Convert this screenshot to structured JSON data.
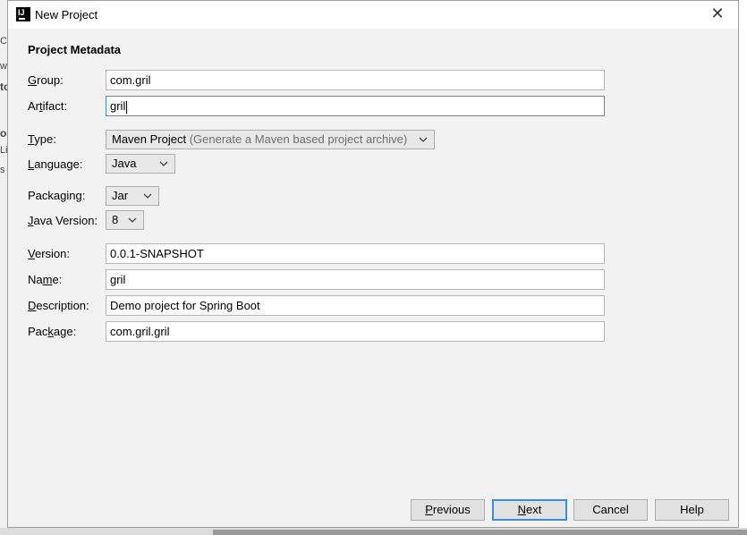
{
  "background_fragments": [
    "C",
    "w",
    "to",
    "oc",
    "Li",
    "s"
  ],
  "window": {
    "title": "New Project",
    "close_glyph": "✕"
  },
  "section": {
    "title": "Project Metadata"
  },
  "fields": {
    "group": {
      "label_pre": "",
      "label_accel": "G",
      "label_post": "roup:",
      "value": "com.gril"
    },
    "artifact": {
      "label_pre": "Ar",
      "label_accel": "t",
      "label_post": "ifact:",
      "value": "gril"
    },
    "version": {
      "label_pre": "",
      "label_accel": "V",
      "label_post": "ersion:",
      "value": "0.0.1-SNAPSHOT"
    },
    "name": {
      "label_pre": "Na",
      "label_accel": "m",
      "label_post": "e:",
      "value": "gril"
    },
    "description": {
      "label_pre": "",
      "label_accel": "D",
      "label_post": "escription:",
      "value": "Demo project for Spring Boot"
    },
    "package": {
      "label_pre": "Pac",
      "label_accel": "k",
      "label_post": "age:",
      "value": "com.gril.gril"
    }
  },
  "selects": {
    "type": {
      "label_pre": "",
      "label_accel": "T",
      "label_post": "ype:",
      "value": "Maven Project",
      "hint": "(Generate a Maven based project archive)"
    },
    "language": {
      "label_pre": "",
      "label_accel": "L",
      "label_post": "anguage:",
      "value": "Java"
    },
    "packaging": {
      "label_pre": "Packa",
      "label_accel": "g",
      "label_post": "ing:",
      "value": "Jar"
    },
    "java_version": {
      "label_pre": "",
      "label_accel": "J",
      "label_post": "ava Version:",
      "value": "8"
    }
  },
  "buttons": {
    "previous": {
      "accel": "P",
      "rest": "revious"
    },
    "next": {
      "accel": "N",
      "rest": "ext"
    },
    "cancel": {
      "label": "Cancel"
    },
    "help": {
      "label": "Help"
    }
  },
  "colors": {
    "focus": "#3c8ce7",
    "dialog_bg": "#f2f2f2"
  }
}
